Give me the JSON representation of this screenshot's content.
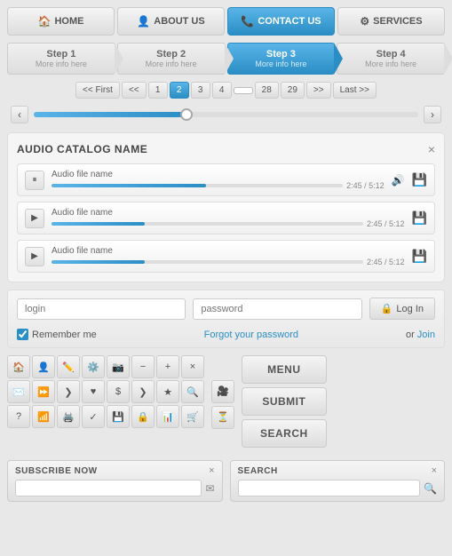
{
  "nav": {
    "items": [
      {
        "id": "home",
        "label": "HOME",
        "icon": "🏠",
        "active": false
      },
      {
        "id": "about",
        "label": "ABOUT US",
        "icon": "👤",
        "active": false
      },
      {
        "id": "contact",
        "label": "CONTACT US",
        "icon": "📞",
        "active": true
      },
      {
        "id": "services",
        "label": "SERVICES",
        "icon": "⚙",
        "active": false
      }
    ]
  },
  "steps": [
    {
      "id": "step1",
      "label": "Step 1",
      "sub": "More info here",
      "active": false
    },
    {
      "id": "step2",
      "label": "Step 2",
      "sub": "More info here",
      "active": false
    },
    {
      "id": "step3",
      "label": "Step 3",
      "sub": "More info here",
      "active": true
    },
    {
      "id": "step4",
      "label": "Step 4",
      "sub": "More info here",
      "active": false
    }
  ],
  "pagination": {
    "first": "<< First",
    "prev2": "<<",
    "pages": [
      "1",
      "2",
      "3",
      "4",
      "",
      "28",
      "29"
    ],
    "active_page": "2",
    "next2": ">>",
    "last": "Last >>"
  },
  "audio": {
    "title": "AUDIO CATALOG NAME",
    "close_label": "×",
    "tracks": [
      {
        "name": "Audio file name",
        "time": "2:45",
        "total": "5:12",
        "progress": 53,
        "playing": true
      },
      {
        "name": "Audio file name",
        "time": "2:45",
        "total": "5:12",
        "progress": 30,
        "playing": false
      },
      {
        "name": "Audio file name",
        "time": "2:45",
        "total": "5:12",
        "progress": 30,
        "playing": false
      }
    ]
  },
  "login": {
    "login_placeholder": "login",
    "password_placeholder": "password",
    "login_btn": "Log In",
    "lock_icon": "🔒",
    "remember_label": "Remember me",
    "forgot_label": "Forgot your password",
    "or_text": "or",
    "join_label": "Join"
  },
  "icons": [
    "🏠",
    "👤",
    "✏",
    "⚙",
    "📷",
    "−",
    "+",
    "×",
    "✉",
    "❯❯",
    "❯",
    "♥",
    "$",
    "❯",
    "★",
    "🔍",
    "?",
    "📶",
    "🖨",
    "✓",
    "🖫",
    "🔒",
    "📊",
    "🛒",
    "",
    "",
    "",
    "",
    "",
    "",
    "⏳",
    ""
  ],
  "action_buttons": {
    "menu": "MENU",
    "submit": "SUBMIT",
    "search": "SEARCH"
  },
  "subscribe": {
    "label": "SUBSCRIBE NOW",
    "close": "×",
    "placeholder": "",
    "icon": "✉"
  },
  "search": {
    "label": "SEARCH",
    "close": "×",
    "placeholder": "",
    "icon": "🔍"
  }
}
